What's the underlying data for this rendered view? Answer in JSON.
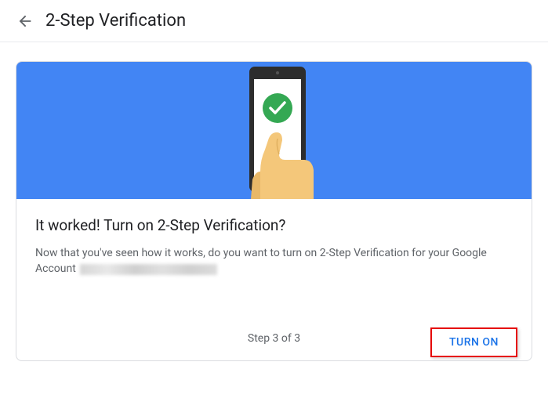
{
  "header": {
    "title": "2-Step Verification"
  },
  "card": {
    "title": "It worked! Turn on 2-Step Verification?",
    "description_prefix": "Now that you've seen how it works, do you want to turn on 2-Step Verification for your Google Account",
    "step_indicator": "Step 3 of 3",
    "turn_on_label": "TURN ON"
  }
}
